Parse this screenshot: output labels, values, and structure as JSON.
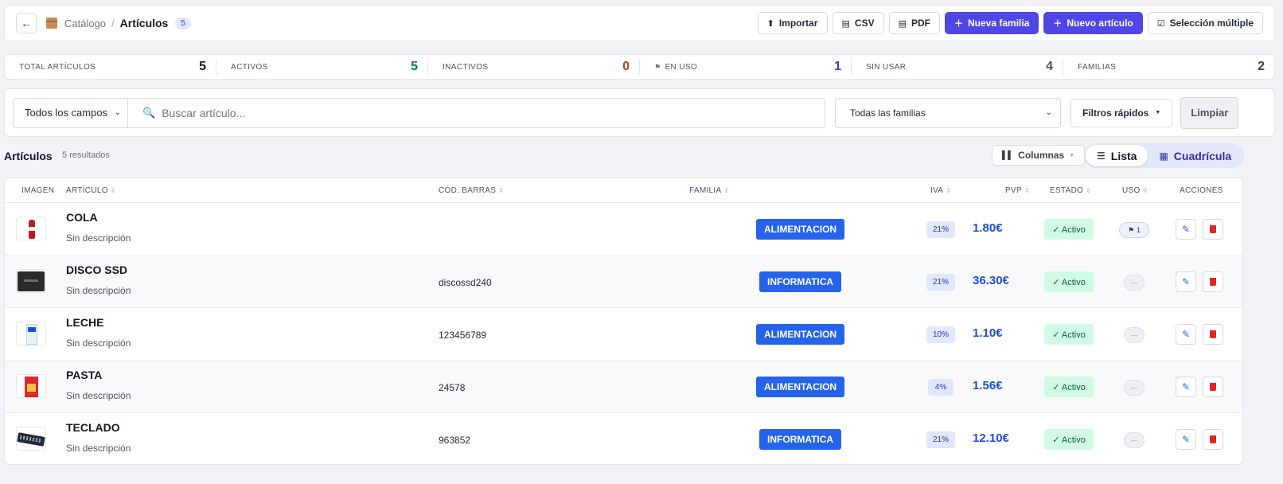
{
  "header": {
    "back_icon": "arrow-left-icon",
    "breadcrumb_parent": "Catálogo",
    "breadcrumb_sep": "/",
    "breadcrumb_current": "Artículos",
    "count": "5",
    "buttons": {
      "import": "Importar",
      "csv": "CSV",
      "pdf": "PDF",
      "new_family": "Nueva familia",
      "new_article": "Nuevo artículo",
      "multi_select": "Selección múltiple"
    }
  },
  "stats": [
    {
      "label": "TOTAL ARTÍCULOS",
      "value": "5",
      "color": "#111827"
    },
    {
      "label": "ACTIVOS",
      "value": "5",
      "color": "#047857"
    },
    {
      "label": "INACTIVOS",
      "value": "0",
      "color": "#c2410c"
    },
    {
      "label": "EN USO",
      "value": "1",
      "color": "#1d4ed8"
    },
    {
      "label": "SIN USAR",
      "value": "4",
      "color": "#4b5563"
    },
    {
      "label": "FAMILIAS",
      "value": "2",
      "color": "#374151"
    }
  ],
  "filters": {
    "field_select": "Todos los campos",
    "search_placeholder": "Buscar artículo...",
    "family_select": "Todas las familias",
    "quick_filters": "Filtros rápidos",
    "clear": "Limpiar"
  },
  "results": {
    "title": "Artículos",
    "count_text": "5 resultados",
    "columns_btn": "Columnas",
    "view_list": "Lista",
    "view_grid": "Cuadrícula"
  },
  "table": {
    "headers": {
      "image": "IMAGEN",
      "article": "ARTÍCULO",
      "barcode": "CÓD. BARRAS",
      "family": "FAMILIA",
      "iva": "IVA",
      "pvp": "PVP",
      "state": "ESTADO",
      "uso": "USO",
      "actions": "ACCIONES"
    },
    "rows": [
      {
        "name": "COLA",
        "desc": "Sin descripción",
        "barcode": "",
        "family": "ALIMENTACION",
        "iva": "21%",
        "pvp": "1.80€",
        "state": "✓ Activo",
        "uso": "1"
      },
      {
        "name": "DISCO SSD",
        "desc": "Sin descripción",
        "barcode": "discossd240",
        "family": "INFORMATICA",
        "iva": "21%",
        "pvp": "36.30€",
        "state": "✓ Activo",
        "uso": "—"
      },
      {
        "name": "LECHE",
        "desc": "Sin descripción",
        "barcode": "123456789",
        "family": "ALIMENTACION",
        "iva": "10%",
        "pvp": "1.10€",
        "state": "✓ Activo",
        "uso": "—"
      },
      {
        "name": "PASTA",
        "desc": "Sin descripción",
        "barcode": "24578",
        "family": "ALIMENTACION",
        "iva": "4%",
        "pvp": "1.56€",
        "state": "✓ Activo",
        "uso": "—"
      },
      {
        "name": "TECLADO",
        "desc": "Sin descripción",
        "barcode": "963852",
        "family": "INFORMATICA",
        "iva": "21%",
        "pvp": "12.10€",
        "state": "✓ Activo",
        "uso": "—"
      }
    ]
  }
}
